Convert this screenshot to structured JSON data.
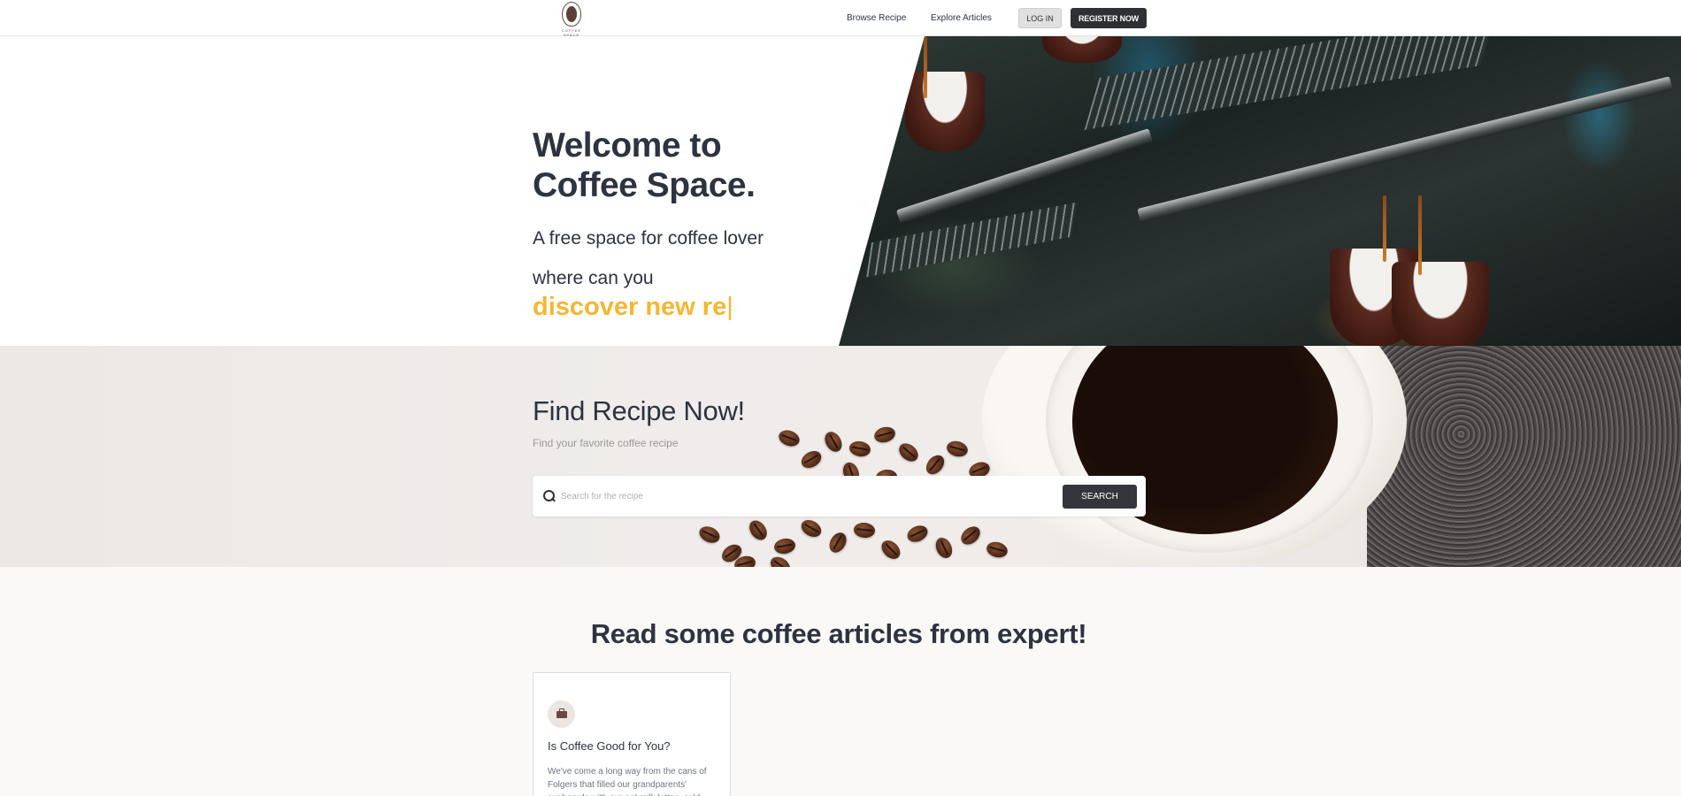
{
  "navbar": {
    "logo_text": "COFFEE SPACE",
    "links": [
      {
        "label": "Browse Recipe"
      },
      {
        "label": "Explore Articles"
      }
    ],
    "login_label": "LOG IN",
    "register_label": "REGISTER NOW"
  },
  "hero": {
    "title_line1": "Welcome to",
    "title_line2": "Coffee Space.",
    "subtitle_line1": "A free space for coffee lover",
    "subtitle_line2": "where can you",
    "typed_text": "discover new re",
    "caret": "|",
    "accent_color": "#f6b634"
  },
  "search": {
    "title": "Find Recipe Now!",
    "subtitle": "Find your favorite coffee recipe",
    "placeholder": "Search for the recipe",
    "value": "",
    "button_label": "SEARCH"
  },
  "articles": {
    "title": "Read some coffee articles from expert!",
    "cards": [
      {
        "icon": "briefcase-icon",
        "title": "Is Coffee Good for You?",
        "excerpt": "We've come a long way from the cans of Folgers that filled our grandparents' cupboards with our oat milk lattes, cold"
      }
    ]
  }
}
